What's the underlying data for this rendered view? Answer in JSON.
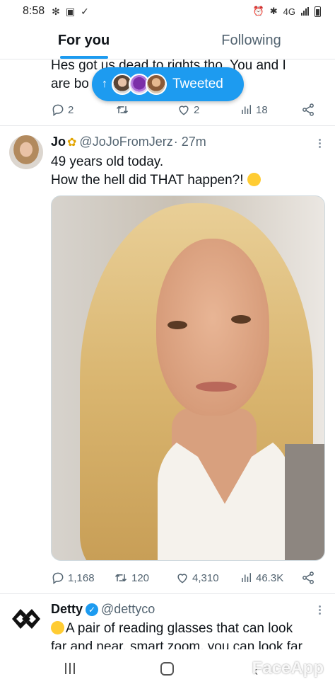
{
  "status_bar": {
    "time": "8:58",
    "network": "4G"
  },
  "tabs": [
    {
      "label": "For you",
      "active": true
    },
    {
      "label": "Following",
      "active": false
    }
  ],
  "accent_color": "#1d9bf0",
  "previous_tweet": {
    "text_line1": "Hes got us dead to rights tho. You and I",
    "text_line2": "are bo",
    "actions": {
      "replies": "2",
      "retweets": "",
      "likes": "2",
      "views": "18"
    }
  },
  "new_tweets_pill": {
    "label": "Tweeted"
  },
  "tweet": {
    "author_name": "Jo",
    "handle": "@JoJoFromJerz",
    "time": "· 27m",
    "text_line1": "49 years old today.",
    "text_line2": "How the hell did THAT happen?!",
    "actions": {
      "replies": "1,168",
      "retweets": "120",
      "likes": "4,310",
      "views": "46.3K"
    }
  },
  "next_tweet": {
    "author_name": "Detty",
    "handle": "@dettyco",
    "text_line1": "A pair of reading glasses that can look",
    "text_line2": "far and near, smart zoom, you can look far"
  },
  "nav_bar": {
    "watermark": "FaceApp"
  }
}
